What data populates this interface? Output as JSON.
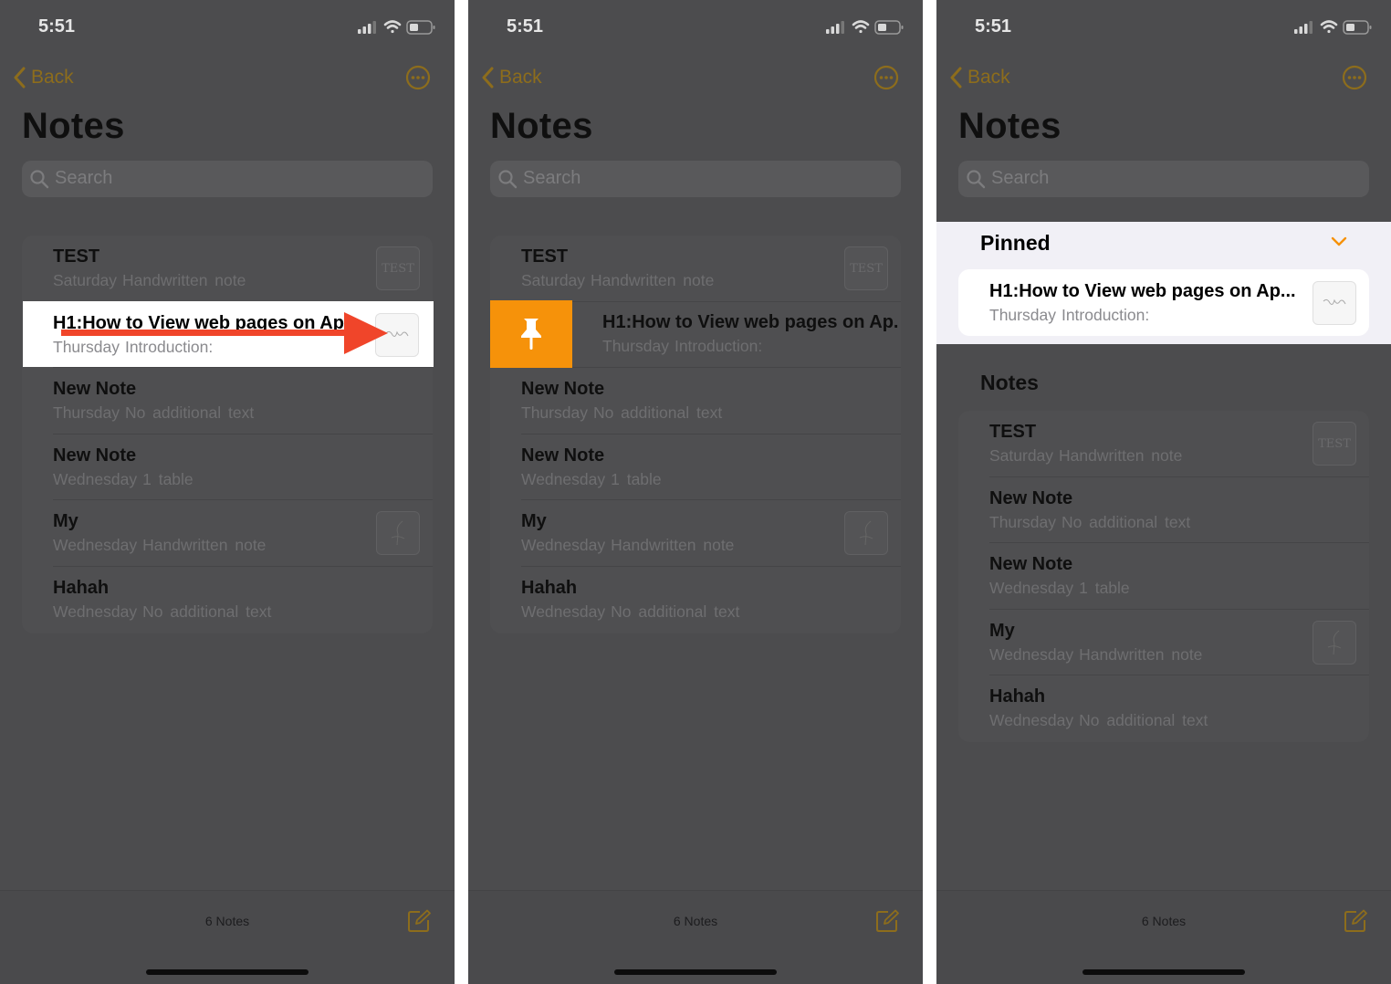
{
  "status": {
    "time": "5:51"
  },
  "nav": {
    "back_label": "Back"
  },
  "title": "Notes",
  "search": {
    "placeholder": "Search"
  },
  "notes": [
    {
      "title": "TEST",
      "date": "Saturday",
      "subtitle": "Handwritten note",
      "thumb": "TEST"
    },
    {
      "title": "H1:How to View web pages on Ap",
      "date": "Thursday",
      "subtitle": "Introduction:",
      "thumb": "sketch"
    },
    {
      "title": "New Note",
      "date": "Thursday",
      "subtitle": "No additional text",
      "thumb": ""
    },
    {
      "title": "New Note",
      "date": "Wednesday",
      "subtitle": "1 table",
      "thumb": ""
    },
    {
      "title": "My",
      "date": "Wednesday",
      "subtitle": "Handwritten note",
      "thumb": "sketch"
    },
    {
      "title": "Hahah",
      "date": "Wednesday",
      "subtitle": "No additional text",
      "thumb": ""
    }
  ],
  "swiped_title": "H1:How to View web pages on Ap.",
  "pinned": {
    "header": "Pinned",
    "note": {
      "title": "H1:How to View web pages on Ap...",
      "date": "Thursday",
      "subtitle": "Introduction:"
    }
  },
  "notes_section_header": "Notes",
  "footer": {
    "count": "6 Notes"
  },
  "colors": {
    "accent": "#f6920a",
    "dimmed_accent": "#8d6d1c",
    "arrow": "#f0452a"
  },
  "icons": [
    "signal-icon",
    "wifi-icon",
    "battery-icon",
    "chevron-left-icon",
    "ellipsis-circle-icon",
    "search-icon",
    "pin-icon",
    "chevron-down-icon",
    "compose-icon"
  ]
}
